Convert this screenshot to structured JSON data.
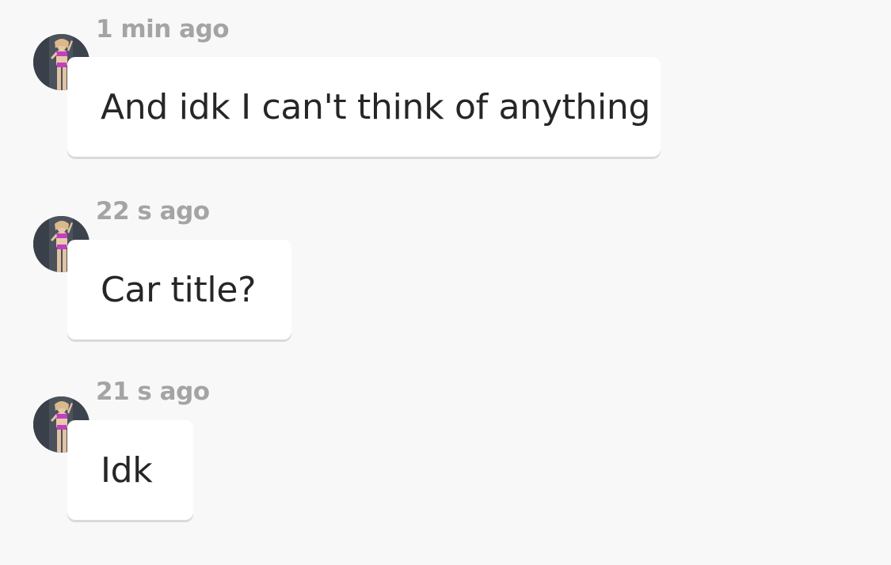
{
  "messages": [
    {
      "timestamp": "1 min ago",
      "text": "And idk I can't think of anything",
      "avatar_icon": "user-photo-avatar"
    },
    {
      "timestamp": "22 s ago",
      "text": "Car title?",
      "avatar_icon": "user-photo-avatar"
    },
    {
      "timestamp": "21 s ago",
      "text": "Idk",
      "avatar_icon": "user-photo-avatar"
    }
  ],
  "colors": {
    "background": "#f8f8f8",
    "bubble": "#ffffff",
    "timestamp": "#a4a4a4",
    "text": "#262626",
    "avatar_accent": "#c040c0"
  }
}
